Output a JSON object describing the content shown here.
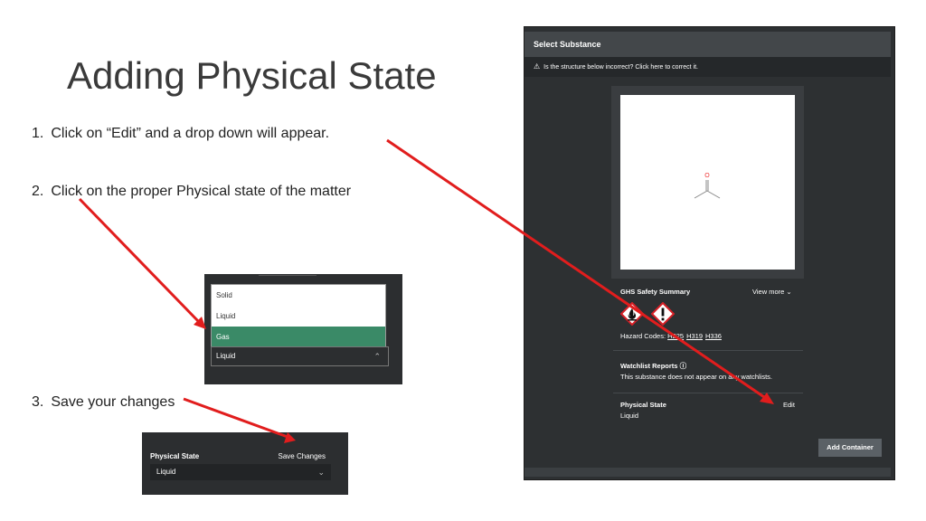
{
  "slide": {
    "title": "Adding Physical State",
    "steps": [
      {
        "num": "1.",
        "text": "Click on “Edit” and a drop down will appear."
      },
      {
        "num": "2.",
        "text": "Click on the proper Physical state of the matter"
      },
      {
        "num": "3.",
        "text": "Save your changes"
      }
    ]
  },
  "dropdown_shot": {
    "options": [
      "Solid",
      "Liquid",
      "Gas"
    ],
    "selected_option": "Gas",
    "current_value": "Liquid"
  },
  "save_shot": {
    "label": "Physical State",
    "save_button": "Save Changes",
    "value": "Liquid"
  },
  "dialog": {
    "title": "Select Substance",
    "warning": "Is the structure below incorrect? Click here to correct it.",
    "structure_atom": "O",
    "ghs_title": "GHS Safety Summary",
    "view_more": "View more",
    "hazard_label": "Hazard Codes:",
    "hazard_codes": [
      "H225",
      "H319",
      "H336"
    ],
    "watchlist_title": "Watchlist Reports",
    "watchlist_text": "This substance does not appear on any watchlists.",
    "physical_state_title": "Physical State",
    "physical_state_value": "Liquid",
    "edit_link": "Edit",
    "add_container": "Add Container"
  },
  "colors": {
    "arrow": "#e11d1d",
    "selected_option": "#3a8a67",
    "dialog_bg": "#2d3032",
    "ghs_red": "#d61f26"
  }
}
